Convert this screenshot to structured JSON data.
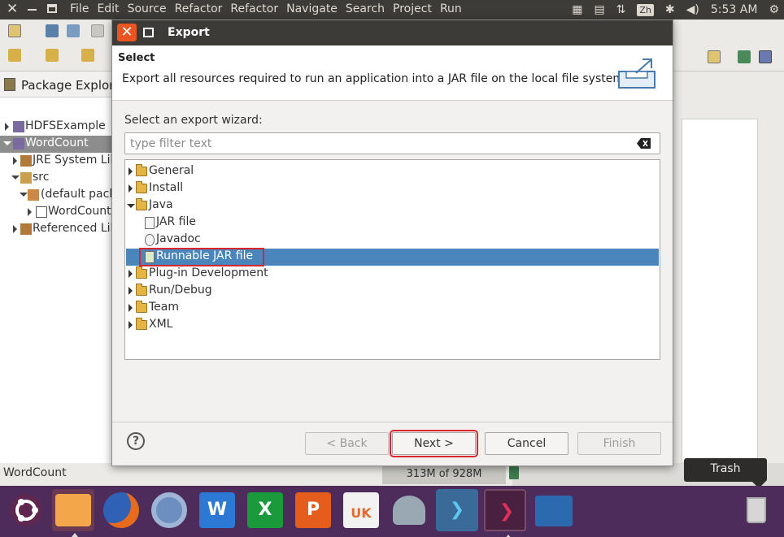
{
  "topbar": {
    "menu": [
      "File",
      "Edit",
      "Source",
      "Refactor",
      "Refactor",
      "Navigate",
      "Search",
      "Project",
      "Run"
    ],
    "lang": "Zh",
    "time": "5:53 AM"
  },
  "package_explorer": {
    "title": "Package Explore",
    "items": [
      {
        "label": "HDFSExample",
        "level": 0,
        "expanded": false
      },
      {
        "label": "WordCount",
        "level": 0,
        "expanded": true,
        "selected": true
      },
      {
        "label": "JRE System Lib",
        "level": 1,
        "expanded": false
      },
      {
        "label": "src",
        "level": 1,
        "expanded": true
      },
      {
        "label": "(default pack",
        "level": 2,
        "expanded": true
      },
      {
        "label": "WordCount",
        "level": 3,
        "expanded": false
      },
      {
        "label": "Referenced Lil",
        "level": 1,
        "expanded": false
      }
    ]
  },
  "status_bar": {
    "left": "WordCount",
    "memory": "313M of 928M"
  },
  "dialog": {
    "title": "Export",
    "header_title": "Select",
    "header_desc": "Export all resources required to run an application into a JAR file on the local file system.",
    "wizard_label": "Select an export wizard:",
    "filter_placeholder": "type filter text",
    "tree": [
      {
        "label": "General",
        "type": "folder",
        "level": 0,
        "expanded": false
      },
      {
        "label": "Install",
        "type": "folder",
        "level": 0,
        "expanded": false
      },
      {
        "label": "Java",
        "type": "folder",
        "level": 0,
        "expanded": true
      },
      {
        "label": "JAR file",
        "type": "file",
        "level": 1
      },
      {
        "label": "Javadoc",
        "type": "file",
        "level": 1
      },
      {
        "label": "Runnable JAR file",
        "type": "file",
        "level": 1,
        "selected": true
      },
      {
        "label": "Plug-in Development",
        "type": "folder",
        "level": 0,
        "expanded": false
      },
      {
        "label": "Run/Debug",
        "type": "folder",
        "level": 0,
        "expanded": false
      },
      {
        "label": "Team",
        "type": "folder",
        "level": 0,
        "expanded": false
      },
      {
        "label": "XML",
        "type": "folder",
        "level": 0,
        "expanded": false
      }
    ],
    "buttons": {
      "back": "< Back",
      "next": "Next >",
      "cancel": "Cancel",
      "finish": "Finish"
    }
  },
  "dock": {
    "tooltip": "Trash",
    "apps": [
      {
        "name": "ubuntu",
        "color": "#5e2750"
      },
      {
        "name": "files",
        "color": "#e8953a"
      },
      {
        "name": "firefox",
        "color": "#3a6fc1"
      },
      {
        "name": "chromium",
        "color": "#4b80c8"
      },
      {
        "name": "writer",
        "color": "#2b79d4"
      },
      {
        "name": "calc",
        "color": "#1a9a3a"
      },
      {
        "name": "impress",
        "color": "#e45d1c"
      },
      {
        "name": "software",
        "color": "#e66a2c"
      },
      {
        "name": "remote",
        "color": "#8a9aa8"
      },
      {
        "name": "terminal",
        "color": "#4a6a8a"
      },
      {
        "name": "terminal2",
        "color": "#6a2a4a"
      },
      {
        "name": "settings",
        "color": "#2c5a8a"
      }
    ]
  },
  "colors": {
    "selection": "#4a85bb",
    "highlight_box": "#d9262e",
    "dock": "#4d2c5c"
  }
}
